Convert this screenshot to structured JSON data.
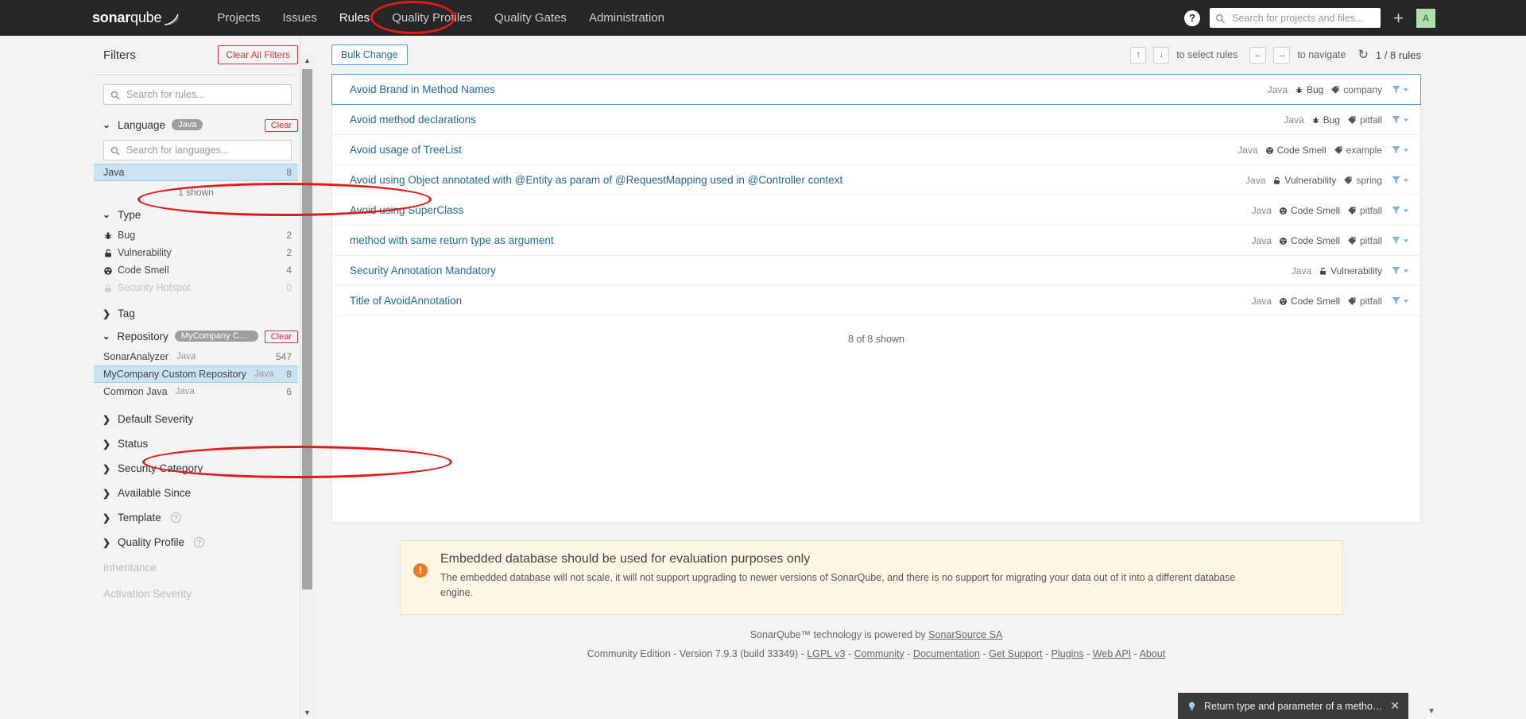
{
  "nav": {
    "brand_bold": "sonar",
    "brand_light": "qube",
    "links": [
      "Projects",
      "Issues",
      "Rules",
      "Quality Profiles",
      "Quality Gates",
      "Administration"
    ],
    "active_link": "Rules",
    "help_glyph": "?",
    "search_placeholder": "Search for projects and files...",
    "plus_glyph": "+",
    "avatar_initial": "A"
  },
  "sidebar": {
    "title": "Filters",
    "clear_all_label": "Clear All Filters",
    "search_placeholder": "Search for rules...",
    "language_facet": {
      "name": "Language",
      "pill": "Java",
      "clear_label": "Clear",
      "search_placeholder": "Search for languages...",
      "items": [
        {
          "label": "Java",
          "count": "8",
          "selected": true
        }
      ],
      "shown_note": "1 shown"
    },
    "type_facet": {
      "name": "Type",
      "items": [
        {
          "label": "Bug",
          "count": "2",
          "icon": "bug-icon"
        },
        {
          "label": "Vulnerability",
          "count": "2",
          "icon": "vulnerability-icon"
        },
        {
          "label": "Code Smell",
          "count": "4",
          "icon": "code-smell-icon"
        },
        {
          "label": "Security Hotspot",
          "count": "0",
          "icon": "security-hotspot-icon",
          "disabled": true
        }
      ]
    },
    "tag_facet": {
      "name": "Tag"
    },
    "repository_facet": {
      "name": "Repository",
      "pill": "MyCompany Cus...",
      "clear_label": "Clear",
      "items": [
        {
          "label": "SonarAnalyzer",
          "sub": "Java",
          "count": "547",
          "selected": false
        },
        {
          "label": "MyCompany Custom Repository",
          "sub": "Java",
          "count": "8",
          "selected": true
        },
        {
          "label": "Common Java",
          "sub": "Java",
          "count": "6",
          "selected": false
        }
      ]
    },
    "collapsed_facets": [
      {
        "name": "Default Severity",
        "help": false
      },
      {
        "name": "Status",
        "help": false
      },
      {
        "name": "Security Category",
        "help": false
      },
      {
        "name": "Available Since",
        "help": false
      },
      {
        "name": "Template",
        "help": true
      },
      {
        "name": "Quality Profile",
        "help": true
      }
    ],
    "muted_facets": [
      "Inheritance",
      "Activation Severity"
    ]
  },
  "toolbar": {
    "bulk_change_label": "Bulk Change",
    "up_key": "↑",
    "down_key": "↓",
    "select_rules_label": "to select rules",
    "left_key": "←",
    "right_key": "→",
    "navigate_label": "to navigate",
    "reload_glyph": "↻",
    "rules_count": "1 / 8 rules"
  },
  "rules": {
    "items": [
      {
        "name": "Avoid Brand in Method Names",
        "lang": "Java",
        "type": "Bug",
        "type_icon": "bug-icon",
        "tag": "company",
        "active": true
      },
      {
        "name": "Avoid method declarations",
        "lang": "Java",
        "type": "Bug",
        "type_icon": "bug-icon",
        "tag": "pitfall",
        "active": false
      },
      {
        "name": "Avoid usage of TreeList",
        "lang": "Java",
        "type": "Code Smell",
        "type_icon": "code-smell-icon",
        "tag": "example",
        "active": false
      },
      {
        "name": "Avoid using Object annotated with @Entity as param of @RequestMapping used in @Controller context",
        "lang": "Java",
        "type": "Vulnerability",
        "type_icon": "vulnerability-icon",
        "tag": "spring",
        "active": false
      },
      {
        "name": "Avoid using SuperClass",
        "lang": "Java",
        "type": "Code Smell",
        "type_icon": "code-smell-icon",
        "tag": "pitfall",
        "active": false
      },
      {
        "name": "method with same return type as argument",
        "lang": "Java",
        "type": "Code Smell",
        "type_icon": "code-smell-icon",
        "tag": "pitfall",
        "active": false
      },
      {
        "name": "Security Annotation Mandatory",
        "lang": "Java",
        "type": "Vulnerability",
        "type_icon": "vulnerability-icon",
        "tag": "",
        "active": false
      },
      {
        "name": "Title of AvoidAnnotation",
        "lang": "Java",
        "type": "Code Smell",
        "type_icon": "code-smell-icon",
        "tag": "pitfall",
        "active": false
      }
    ],
    "shown_footer": "8 of 8 shown"
  },
  "alert": {
    "icon_glyph": "!",
    "title": "Embedded database should be used for evaluation purposes only",
    "body": "The embedded database will not scale, it will not support upgrading to newer versions of SonarQube, and there is no support for migrating your data out of it into a different database engine."
  },
  "footer": {
    "line1_prefix": "SonarQube™ technology is powered by ",
    "line1_link": "SonarSource SA",
    "edition": "Community Edition",
    "version": "Version 7.9.3 (build 33349)",
    "links": [
      "LGPL v3",
      "Community",
      "Documentation",
      "Get Support",
      "Plugins",
      "Web API",
      "About"
    ],
    "separator": " - "
  },
  "toast": {
    "bulb_glyph": "💡",
    "message": "Return type and parameter of a method should n...",
    "close_glyph": "✕"
  },
  "colors": {
    "nav_bg": "#262626",
    "accent_blue": "#236a97",
    "selected_facet_bg": "#cae3f2",
    "clear_red": "#d4333f",
    "alert_bg": "#fcf8e3",
    "annotation_red": "#e01b1b",
    "avatar_bg": "#b0e0b0"
  }
}
